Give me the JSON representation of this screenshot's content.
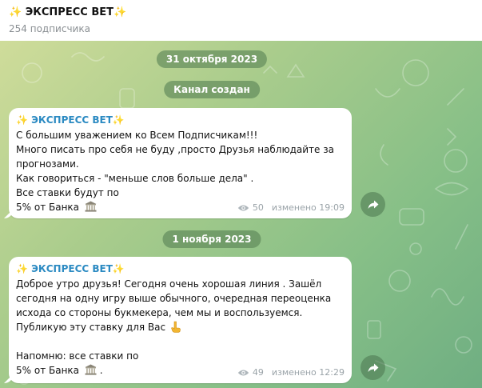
{
  "channel": {
    "title": "✨ ЭКСПРЕСС BET✨",
    "subscribers": "254 подписчика"
  },
  "colors": {
    "author": "#2b8ac2",
    "date_pill_bg": "rgba(89,130,85,0.62)",
    "bubble": "#ffffff"
  },
  "chat": {
    "date1": "31 октября 2023",
    "service": "Канал создан",
    "date2": "1 ноября 2023",
    "messages": [
      {
        "author": "✨ ЭКСПРЕСС BET✨",
        "lines": [
          "С большим уважением ко Всем Подписчикам!!!",
          "Много писать про себя не буду ,просто Друзья наблюдайте за",
          "прогнозами.",
          "Как говориться - \"меньше слов больше дела\" .",
          "Все ставки будут по",
          "5% от Банка"
        ],
        "emoji": "bank-icon",
        "views": "50",
        "status": "изменено 19:09"
      },
      {
        "author": "✨ ЭКСПРЕСС BET✨",
        "lines": [
          "Доброе утро друзья! Сегодня очень хорошая линия . Зашёл",
          "сегодня на одну игру выше обычного, очередная переоценка",
          "исхода со стороны букмекера, чем мы и воспользуемся.",
          "Публикую эту ставку для Вас",
          "",
          "Напомню: все ставки по",
          "5% от Банка",
          "."
        ],
        "emoji": "bank-icon",
        "views": "49",
        "status": "изменено 12:29"
      }
    ]
  }
}
